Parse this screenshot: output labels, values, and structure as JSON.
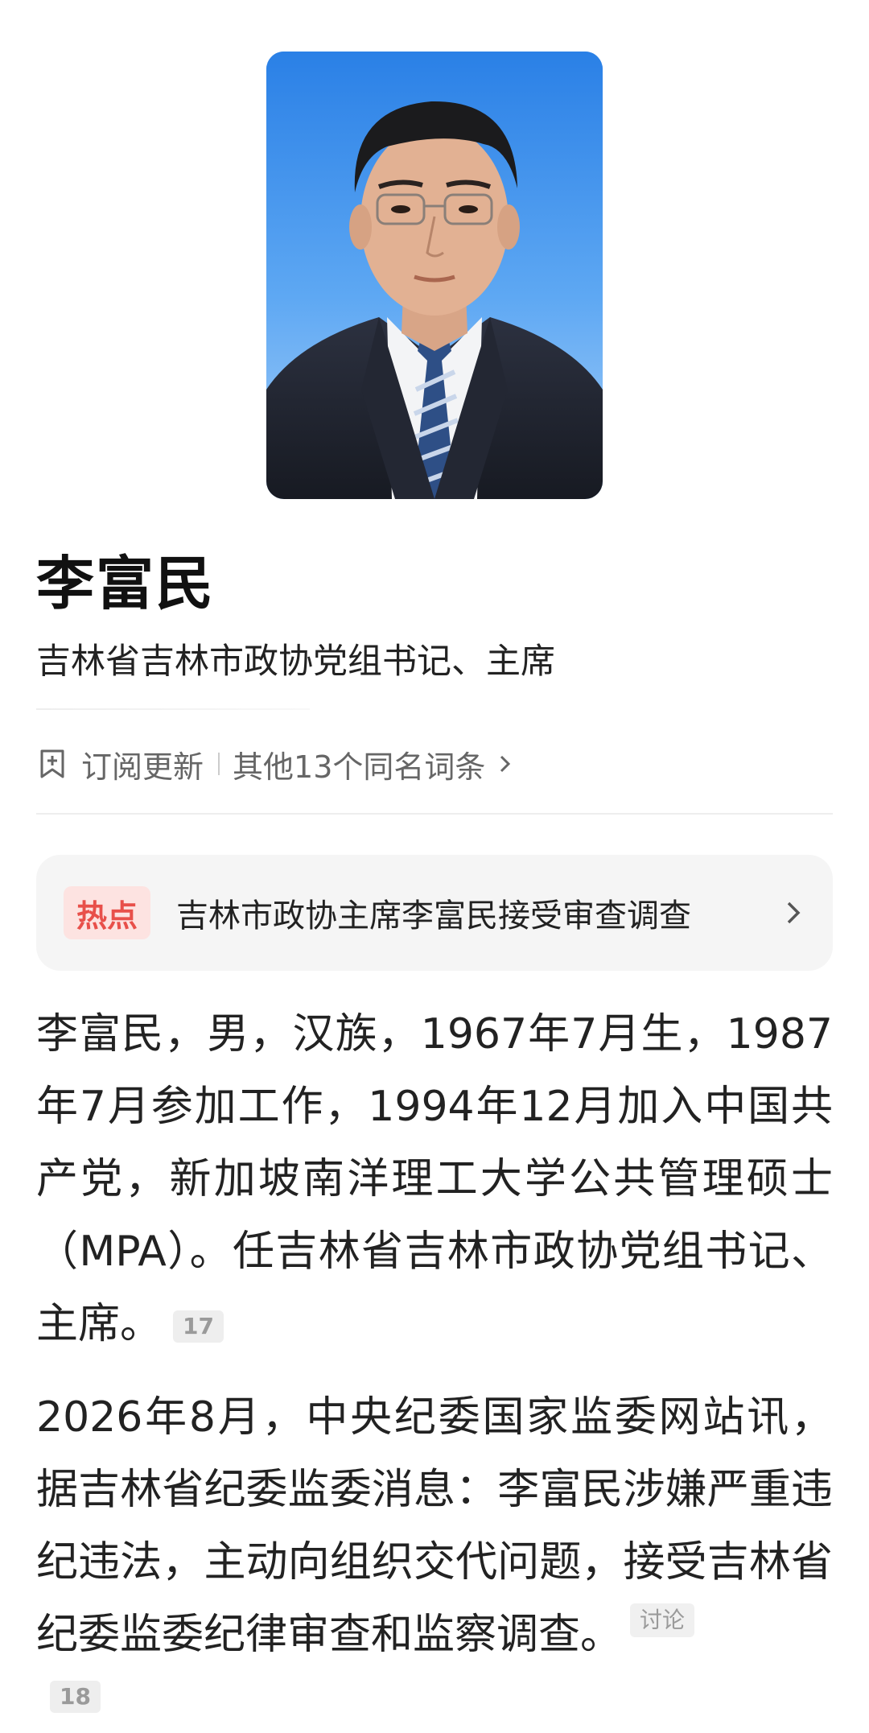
{
  "profile": {
    "photo_icon": "portrait-photo",
    "name": "李富民",
    "title": "吉林省吉林市政协党组书记、主席"
  },
  "actions": {
    "subscribe_icon": "bookmark-plus-icon",
    "subscribe_label": "订阅更新",
    "others_label": "其他13个同名词条"
  },
  "hot": {
    "badge": "热点",
    "text": "吉林市政协主席李富民接受审查调查",
    "badge_color": "#e8504a"
  },
  "paragraphs": {
    "p1": "李富民，男，汉族，1967年7月生，1987年7月参加工作，1994年12月加入中国共产党，新加坡南洋理工大学公共管理硕士（MPA）。任吉林省吉林市政协党组书记、主席。",
    "p1_ref": "17",
    "p2": "2026年8月，中央纪委国家监委网站讯，据吉林省纪委监委消息：李富民涉嫌严重违纪违法，主动向组织交代问题，接受吉林省纪委监委纪律审查和监察调查。",
    "p2_discuss": "讨论",
    "p2_ref": "18"
  }
}
